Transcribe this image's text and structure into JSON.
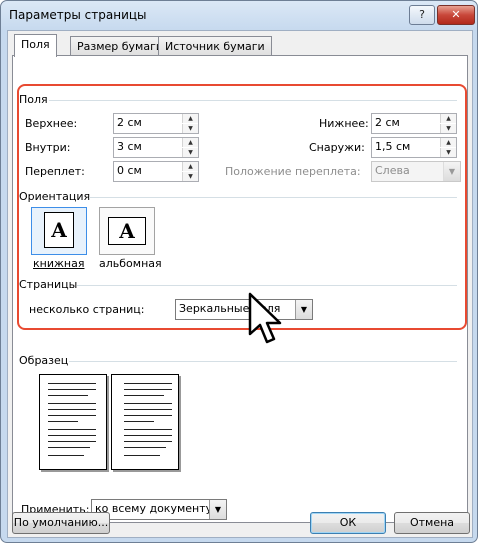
{
  "window": {
    "title": "Параметры страницы",
    "help": "?",
    "close": "✕"
  },
  "tabs": [
    {
      "label": "Поля"
    },
    {
      "label": "Размер бумаги"
    },
    {
      "label": "Источник бумаги"
    }
  ],
  "margins": {
    "group_label": "Поля",
    "top": {
      "label": "Верхнее:",
      "value": "2 см"
    },
    "bottom": {
      "label": "Нижнее:",
      "value": "2 см"
    },
    "inside": {
      "label": "Внутри:",
      "value": "3 см"
    },
    "outside": {
      "label": "Снаружи:",
      "value": "1,5 см"
    },
    "gutter": {
      "label": "Переплет:",
      "value": "0 см"
    },
    "gutter_pos": {
      "label": "Положение переплета:",
      "value": "Слева"
    }
  },
  "orientation": {
    "group_label": "Ориентация",
    "portrait": "книжная",
    "landscape": "альбомная",
    "glyph": "A"
  },
  "pages": {
    "group_label": "Страницы",
    "multiple_label": "несколько страниц:",
    "multiple_value": "Зеркальные поля"
  },
  "preview": {
    "group_label": "Образец"
  },
  "apply": {
    "label": "Применить:",
    "value": "ко всему документу"
  },
  "buttons": {
    "default": "По умолчанию...",
    "ok": "ОК",
    "cancel": "Отмена"
  },
  "icons": {
    "dropdown": "▼",
    "spin_up": "▲",
    "spin_down": "▼"
  }
}
